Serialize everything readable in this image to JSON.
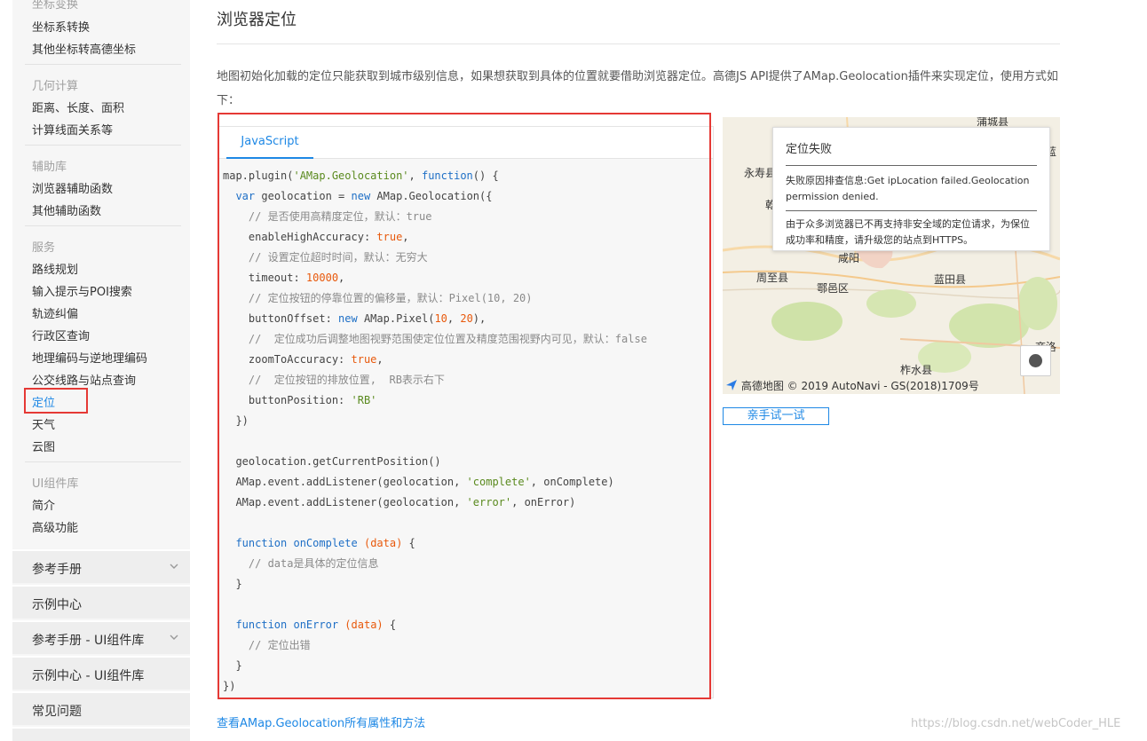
{
  "sidebar": {
    "groups": [
      {
        "title": "坐标变换",
        "items": [
          "坐标系转换",
          "其他坐标转高德坐标"
        ]
      },
      {
        "title": "几何计算",
        "items": [
          "距离、长度、面积",
          "计算线面关系等"
        ]
      },
      {
        "title": "辅助库",
        "items": [
          "浏览器辅助函数",
          "其他辅助函数"
        ]
      },
      {
        "title": "服务",
        "items": [
          "路线规划",
          "输入提示与POI搜索",
          "轨迹纠偏",
          "行政区查询",
          "地理编码与逆地理编码",
          "公交线路与站点查询",
          "定位",
          "天气",
          "云图"
        ]
      },
      {
        "title": "UI组件库",
        "items": [
          "简介",
          "高级功能"
        ]
      }
    ],
    "active_item": "定位",
    "sections": [
      "参考手册",
      "示例中心",
      "参考手册 - UI组件库",
      "示例中心 - UI组件库",
      "常见问题"
    ]
  },
  "main": {
    "title": "浏览器定位",
    "intro": "地图初始化加载的定位只能获取到城市级别信息，如果想获取到具体的位置就要借助浏览器定位。高德JS API提供了AMap.Geolocation插件来实现定位，使用方式如下：",
    "tab_label": "JavaScript",
    "code": {
      "l1": "map.plugin(",
      "l1s": "'AMap.Geolocation'",
      "l1b": ", ",
      "l1k": "function",
      "l1c": "() {",
      "l2a": "  ",
      "l2k": "var",
      "l2b": " geolocation = ",
      "l2n": "new",
      "l2c": " AMap.Geolocation({",
      "c1": "    // 是否使用高精度定位，默认：true",
      "p1": "    enableHighAccuracy: ",
      "v1": "true",
      "c2": "    // 设置定位超时时间，默认：无穷大",
      "p2": "    timeout: ",
      "v2": "10000",
      "c3": "    // 定位按钮的停靠位置的偏移量，默认：Pixel(10, 20)",
      "p3a": "    buttonOffset: ",
      "p3k": "new",
      "p3b": " AMap.Pixel(",
      "p3n1": "10",
      "p3c": ", ",
      "p3n2": "20",
      "p3d": "),",
      "c4": "    //  定位成功后调整地图视野范围使定位位置及精度范围视野内可见，默认：false",
      "p4": "    zoomToAccuracy: ",
      "v4": "true",
      "c5": "    //  定位按钮的排放位置,  RB表示右下",
      "p5": "    buttonPosition: ",
      "v5": "'RB'",
      "close1": "  })",
      "g1": "  geolocation.getCurrentPosition()",
      "e1a": "  AMap.event.addListener(geolocation, ",
      "e1s": "'complete'",
      "e1b": ", onComplete)",
      "e2a": "  AMap.event.addListener(geolocation, ",
      "e2s": "'error'",
      "e2b": ", onError)",
      "f1k": "function",
      "f1n": "onComplete",
      "f1p": "(data)",
      "f1c": " {",
      "f1cm": "    // data是具体的定位信息",
      "f1e": "  }",
      "f2k": "function",
      "f2n": "onError",
      "f2p": "(data)",
      "f2c": " {",
      "f2cm": "    // 定位出错",
      "f2e": "  }",
      "end": "})"
    },
    "map": {
      "labels": [
        "蒲城县",
        "永寿县",
        "乾",
        "咸阳",
        "周至县",
        "鄠邑区",
        "蓝田县",
        "商洛",
        "柞水县",
        "蓝"
      ],
      "popup_title": "定位失败",
      "popup_reason": "失败原因排查信息:Get ipLocation failed.Geolocation permission denied.",
      "popup_note": "由于众多浏览器已不再支持非安全域的定位请求，为保位成功率和精度，请升级您的站点到HTTPS。",
      "footer": "高德地图 © 2019 AutoNavi - GS(2018)1709号"
    },
    "try_button": "亲手试一试",
    "bottom_link": "查看AMap.Geolocation所有属性和方法",
    "watermark": "https://blog.csdn.net/webCoder_HLE"
  },
  "colors": {
    "accent": "#1e88e5",
    "highlight": "#e53935"
  }
}
